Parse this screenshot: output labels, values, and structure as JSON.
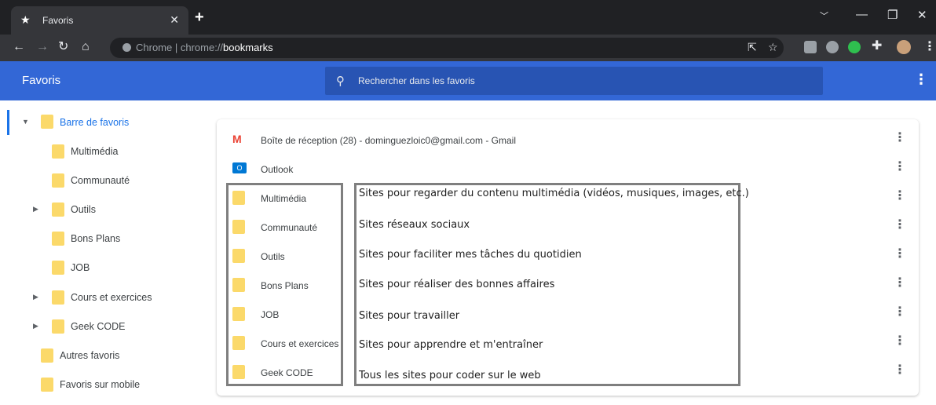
{
  "browser": {
    "tab_title": "Favoris",
    "omnibox_site": "Chrome",
    "omnibox_url_prefix": "chrome://",
    "omnibox_url_path": "bookmarks"
  },
  "header": {
    "app_name": "Favoris",
    "search_placeholder": "Rechercher dans les favoris"
  },
  "sidebar": {
    "items": [
      {
        "label": "Barre de favoris",
        "selected": true,
        "expanded": true
      },
      {
        "label": "Multimédia"
      },
      {
        "label": "Communauté"
      },
      {
        "label": "Outils",
        "has_children": true
      },
      {
        "label": "Bons Plans"
      },
      {
        "label": "JOB"
      },
      {
        "label": "Cours et exercices",
        "has_children": true
      },
      {
        "label": "Geek CODE",
        "has_children": true
      },
      {
        "label": "Autres favoris"
      },
      {
        "label": "Favoris sur mobile"
      }
    ]
  },
  "main": {
    "rows": [
      {
        "label": "Boîte de réception (28) - dominguezloic0@gmail.com - Gmail",
        "icon": "gmail-icon"
      },
      {
        "label": "Outlook",
        "icon": "outlook-icon"
      },
      {
        "label": "Multimédia",
        "icon": "folder-icon"
      },
      {
        "label": "Communauté",
        "icon": "folder-icon"
      },
      {
        "label": "Outils",
        "icon": "folder-icon"
      },
      {
        "label": "Bons Plans",
        "icon": "folder-icon"
      },
      {
        "label": "JOB",
        "icon": "folder-icon"
      },
      {
        "label": "Cours et exercices",
        "icon": "folder-icon"
      },
      {
        "label": "Geek CODE",
        "icon": "folder-icon"
      }
    ]
  },
  "annotations": [
    "Sites pour regarder du contenu multimédia (vidéos, musiques, images, etc.)",
    "Sites réseaux sociaux",
    "Sites pour faciliter mes tâches du quotidien",
    "Sites pour réaliser des bonnes affaires",
    "Sites pour travailler",
    "Sites pour apprendre et m'entraîner",
    "Tous les sites pour coder sur le web"
  ],
  "colors": {
    "header_blue": "#3367d6",
    "folder_yellow": "#fbd96a",
    "selection_blue": "#1a73e8"
  }
}
